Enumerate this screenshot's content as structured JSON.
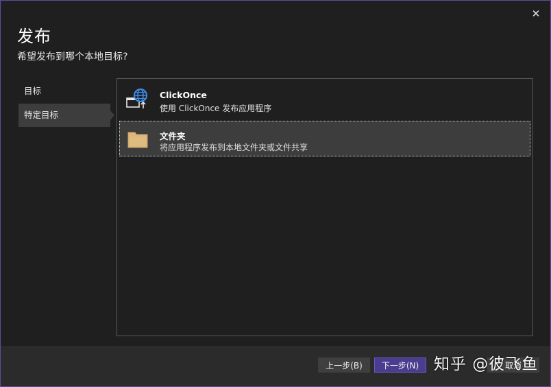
{
  "dialog": {
    "title": "发布",
    "subtitle": "希望发布到哪个本地目标?",
    "close_glyph": "✕"
  },
  "nav": {
    "items": [
      {
        "label": "目标"
      },
      {
        "label": "特定目标"
      }
    ],
    "selected_index": 1
  },
  "targets": [
    {
      "name": "ClickOnce",
      "description": "使用 ClickOnce 发布应用程序",
      "icon": "clickonce-globe-icon"
    },
    {
      "name": "文件夹",
      "description": "将应用程序发布到本地文件夹或文件共享",
      "icon": "folder-icon"
    }
  ],
  "selected_target_index": 1,
  "footer": {
    "back_label": "上一步(B)",
    "next_label": "下一步(N)",
    "cancel_label": "取消"
  },
  "watermark": {
    "text": "知乎 @彼飞鱼"
  },
  "colors": {
    "accent": "#4a3d8f",
    "window_border": "#5b4fa6",
    "background": "#1f1f1f",
    "selected": "#3d3d3d",
    "globe_blue": "#3c8ce7",
    "folder_yellow": "#dcb67a"
  }
}
